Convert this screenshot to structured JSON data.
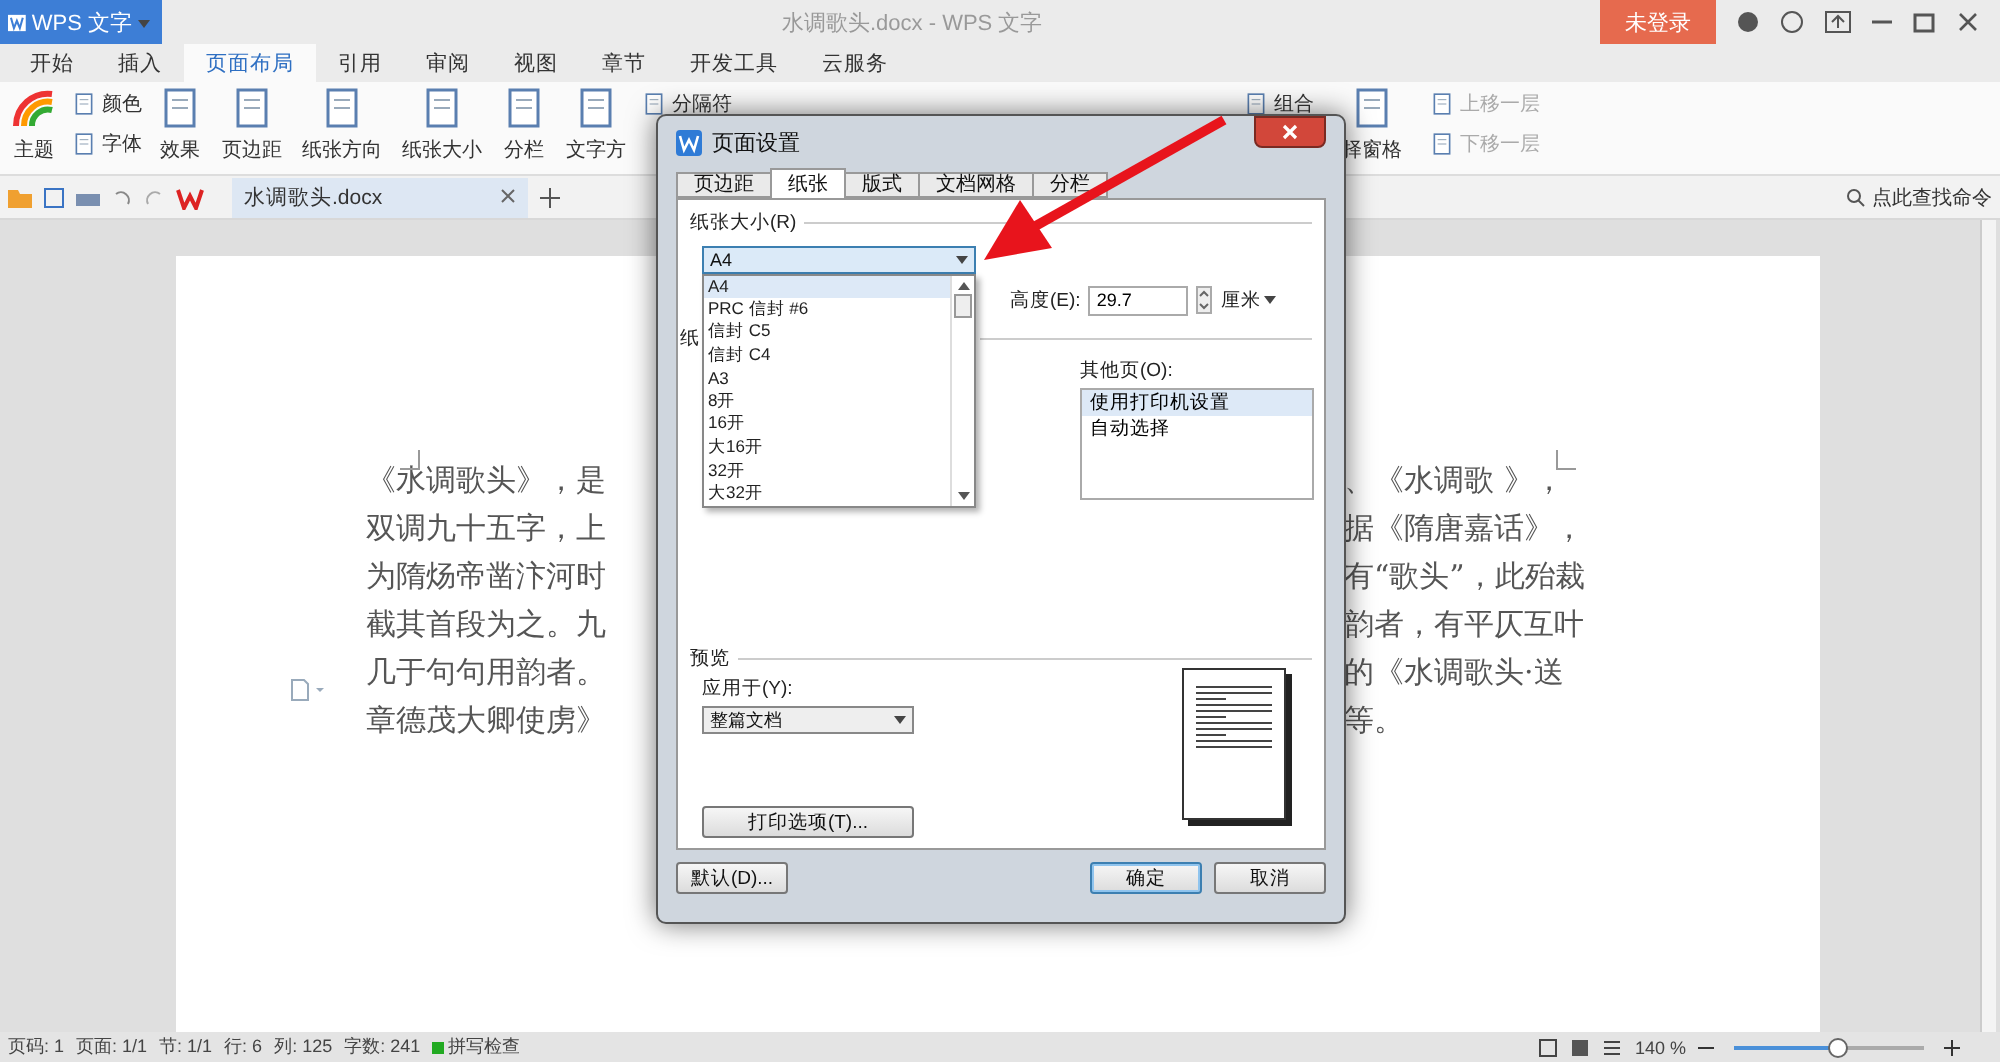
{
  "app": {
    "logo": "WPS 文字",
    "title": "水调歌头.docx - WPS 文字",
    "login": "未登录"
  },
  "menu_tabs": [
    {
      "label": "开始",
      "selected": false
    },
    {
      "label": "插入",
      "selected": false
    },
    {
      "label": "页面布局",
      "selected": true
    },
    {
      "label": "引用",
      "selected": false
    },
    {
      "label": "审阅",
      "selected": false
    },
    {
      "label": "视图",
      "selected": false
    },
    {
      "label": "章节",
      "selected": false
    },
    {
      "label": "开发工具",
      "selected": false
    },
    {
      "label": "云服务",
      "selected": false
    }
  ],
  "ribbon_left": [
    {
      "kind": "large",
      "label": "主题"
    },
    {
      "kind": "stack",
      "items": [
        {
          "label": "颜色",
          "disabled": false
        },
        {
          "label": "字体",
          "disabled": false
        }
      ]
    },
    {
      "kind": "large",
      "label": "效果"
    },
    {
      "kind": "large",
      "label": "页边距"
    },
    {
      "kind": "large",
      "label": "纸张方向"
    },
    {
      "kind": "large",
      "label": "纸张大小"
    },
    {
      "kind": "large",
      "label": "分栏"
    },
    {
      "kind": "large",
      "label": "文字方"
    },
    {
      "kind": "stack",
      "items": [
        {
          "label": "分隔符",
          "disabled": false
        }
      ]
    }
  ],
  "ribbon_right": [
    {
      "kind": "stack",
      "items": [
        {
          "label": "组合",
          "disabled": false
        }
      ]
    },
    {
      "kind": "large",
      "label": "择窗格"
    },
    {
      "kind": "stack",
      "items": [
        {
          "label": "上移一层",
          "disabled": true
        },
        {
          "label": "下移一层",
          "disabled": true
        }
      ]
    }
  ],
  "document_tab": {
    "label": "水调歌头.docx"
  },
  "command_search": "点此查找命令",
  "document": {
    "lines": [
      {
        "left": "《水调歌头》，是",
        "right": "、《水调歌 》，"
      },
      {
        "left": "双调九十五字，上",
        "right": "据《隋唐嘉话》，"
      },
      {
        "left": "为隋炀帝凿汴河时",
        "right": "有“歌头”，此殆裁"
      },
      {
        "left": "截其首段为之。九",
        "right": "韵者，有平仄互叶"
      },
      {
        "left": "几于句句用韵者。",
        "right": "的《水调歌头·送"
      },
      {
        "left": "章德茂大卿使虏》",
        "right": "等。"
      }
    ]
  },
  "dialog": {
    "title": "页面设置",
    "tabs": [
      {
        "label": "页边距",
        "selected": false
      },
      {
        "label": "纸张",
        "selected": true
      },
      {
        "label": "版式",
        "selected": false
      },
      {
        "label": "文档网格",
        "selected": false
      },
      {
        "label": "分栏",
        "selected": false
      }
    ],
    "paper_size": {
      "label": "纸张大小(R)",
      "value": "A4",
      "options": [
        {
          "label": "A4",
          "selected": true
        },
        {
          "label": "PRC 信封 #6",
          "selected": false
        },
        {
          "label": "信封 C5",
          "selected": false
        },
        {
          "label": "信封 C4",
          "selected": false
        },
        {
          "label": "A3",
          "selected": false
        },
        {
          "label": "8开",
          "selected": false
        },
        {
          "label": "16开",
          "selected": false
        },
        {
          "label": "大16开",
          "selected": false
        },
        {
          "label": "32开",
          "selected": false
        },
        {
          "label": "大32开",
          "selected": false
        }
      ]
    },
    "height": {
      "label": "高度(E):",
      "value": "29.7",
      "unit": "厘米"
    },
    "partial_label": "纸",
    "other_pages": {
      "label": "其他页(O):",
      "options": [
        {
          "label": "使用打印机设置",
          "selected": true
        },
        {
          "label": "自动选择",
          "selected": false
        }
      ]
    },
    "preview": {
      "label": "预览",
      "apply_label": "应用于(Y):",
      "apply_value": "整篇文档",
      "print_options": "打印选项(T)..."
    },
    "buttons": [
      {
        "label": "默认(D)...",
        "focused": false
      },
      {
        "label": "确定",
        "focused": true
      },
      {
        "label": "取消",
        "focused": false
      }
    ]
  },
  "status_bar": {
    "items": [
      "页码: 1",
      "页面: 1/1",
      "节: 1/1",
      "行: 6",
      "列: 125",
      "字数: 241",
      "拼写检查"
    ],
    "zoom": "140 %",
    "zoom_slider": {
      "level": 0.55
    }
  }
}
